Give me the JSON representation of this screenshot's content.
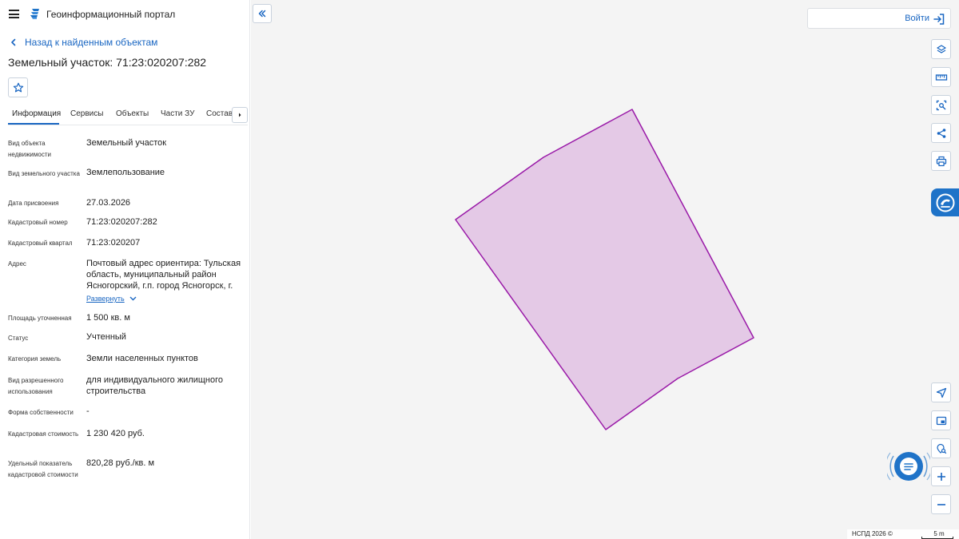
{
  "header": {
    "portal_title": "Геоинформационный портал"
  },
  "nav": {
    "back_label": "Назад к найденным объектам"
  },
  "object": {
    "title": "Земельный участок: 71:23:020207:282"
  },
  "tabs": [
    {
      "label": "Информация",
      "active": true
    },
    {
      "label": "Сервисы"
    },
    {
      "label": "Объекты"
    },
    {
      "label": "Части ЗУ"
    },
    {
      "label": "Состав"
    }
  ],
  "properties": [
    {
      "label": "Вид объекта недвижимости",
      "value": "Земельный участок"
    },
    {
      "label": "Вид земельного участка",
      "value": "Землепользование"
    },
    {
      "label": "Дата присвоения",
      "value": "27.03.2026"
    },
    {
      "label": "Кадастровый номер",
      "value": "71:23:020207:282"
    },
    {
      "label": "Кадастровый квартал",
      "value": "71:23:020207"
    },
    {
      "label": "Адрес",
      "value": "Почтовый адрес ориентира: Тульская область, муниципальный район Ясногорский, г.п. город Ясногорск, г.",
      "expand_label": "Развернуть"
    },
    {
      "label": "Площадь уточненная",
      "value": "1 500 кв. м"
    },
    {
      "label": "Статус",
      "value": "Учтенный"
    },
    {
      "label": "Категория земель",
      "value": "Земли населенных пунктов"
    },
    {
      "label": "Вид разрешенного использования",
      "value": "для индивидуального жилищного строительства"
    },
    {
      "label": "Форма собственности",
      "value": "-"
    },
    {
      "label": "Кадастровая стоимость",
      "value": "1 230 420 руб."
    },
    {
      "label": "Удельный показатель кадастровой стоимости",
      "value": "820,28 руб./кв. м"
    }
  ],
  "map": {
    "login_label": "Войти",
    "attribution": "НСПД 2026 ©",
    "scale_label": "5 m",
    "parcel_fill": "#e4c9e6",
    "parcel_stroke": "#9a1aa8"
  },
  "colors": {
    "accent": "#1966c2",
    "map_background": "#f4f4f4"
  },
  "icons": {
    "menu": "hamburger-icon",
    "logo": "portal-logo-icon",
    "back": "chevron-left-icon",
    "favorite": "star-icon",
    "tabs_next": "chevron-right-icon",
    "collapse": "double-chevron-left-icon",
    "login": "login-icon",
    "tools": [
      "layers-icon",
      "ruler-icon",
      "area-select-icon",
      "share-icon",
      "print-icon",
      "geolocation-icon",
      "minimap-icon",
      "location-search-icon",
      "zoom-in-icon",
      "zoom-out-icon"
    ],
    "side_tab": "support-icon",
    "chat": "chat-icon"
  }
}
